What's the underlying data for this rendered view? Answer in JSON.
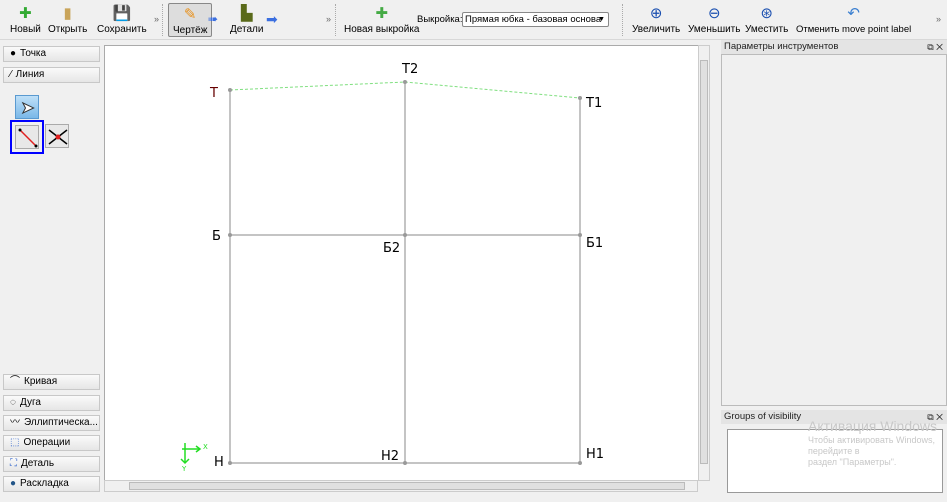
{
  "toolbar": {
    "new": "Новый",
    "open": "Открыть",
    "save": "Сохранить",
    "draw": "Чертёж",
    "details": "Детали",
    "new_pattern": "Новая выкройка",
    "pattern_label": "Выкройка:",
    "pattern_value": "Прямая юбка - базовая основа",
    "zoom_in": "Увеличить",
    "zoom_out": "Уменьшить",
    "fit": "Уместить",
    "undo": "Отменить move point label",
    "more": "»"
  },
  "tools": {
    "point": "Точка",
    "line": "Линия",
    "curve": "Кривая",
    "arc": "Дуга",
    "elliptical": "Эллиптическа...",
    "operations": "Операции",
    "detail": "Деталь",
    "layout": "Раскладка"
  },
  "docks": {
    "tool_options": "Параметры инструментов",
    "groups": "Groups of visibility"
  },
  "drawing": {
    "points": {
      "T": "Т",
      "T2": "Т2",
      "T1": "Т1",
      "B": "Б",
      "B2": "Б2",
      "B1": "Б1",
      "H": "Н",
      "H2": "Н2",
      "H1": "Н1"
    },
    "axis_x": "X",
    "axis_y": "Y"
  },
  "watermark": {
    "line1": "Активация Windows",
    "line2": "Чтобы активировать Windows, перейдите в",
    "line3": "раздел \"Параметры\"."
  },
  "colors": {
    "active_tool_border": "#0000ff",
    "line": "#888888",
    "dashed": "#7fdf7f",
    "axis": "#22dd22"
  }
}
